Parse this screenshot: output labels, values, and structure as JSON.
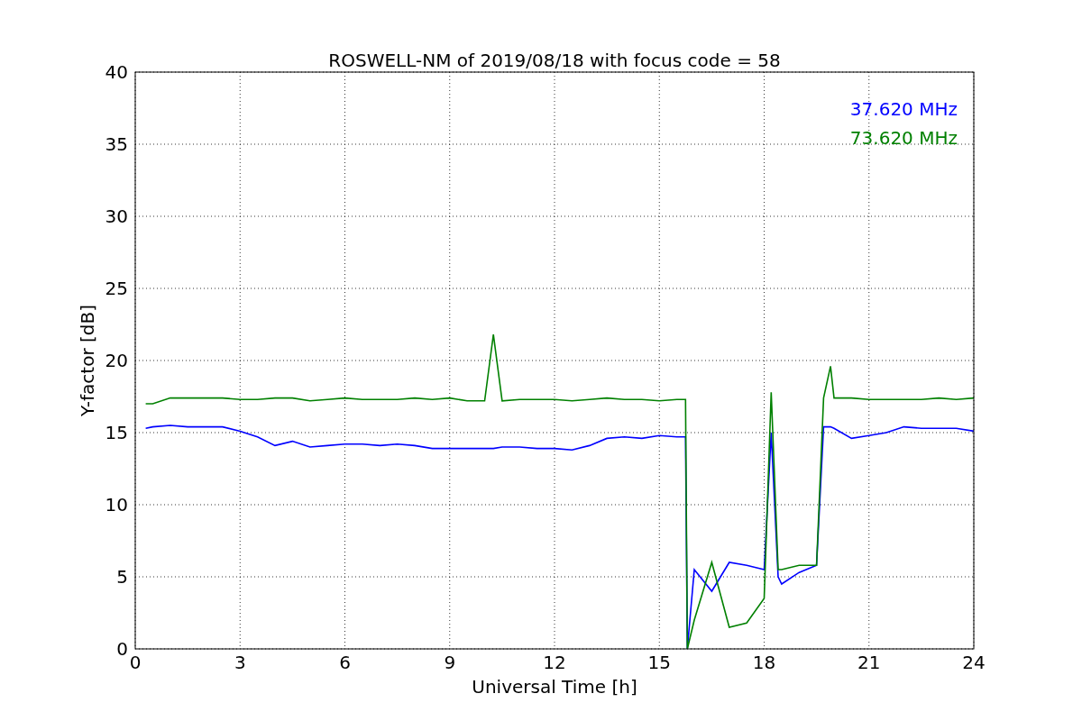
{
  "figure": {
    "chart_data": {
      "type": "line",
      "title": "ROSWELL-NM of 2019/08/18 with focus code = 58",
      "xlabel": "Universal Time [h]",
      "ylabel": "Y-factor [dB]",
      "x": [
        0.3,
        0.5,
        1,
        1.5,
        2,
        2.5,
        3,
        3.5,
        4,
        4.5,
        5,
        5.5,
        6,
        6.5,
        7,
        7.5,
        8,
        8.5,
        9,
        9.5,
        10,
        10.25,
        10.5,
        11,
        11.5,
        12,
        12.5,
        13,
        13.5,
        14,
        14.5,
        15,
        15.5,
        15.75,
        15.8,
        16,
        16.5,
        17,
        17.5,
        18,
        18.2,
        18.4,
        18.5,
        19,
        19.5,
        19.7,
        19.9,
        20,
        20.5,
        21,
        21.5,
        22,
        22.5,
        23,
        23.5,
        24
      ],
      "series": [
        {
          "name": "37.620 MHz",
          "color": "#0000ff",
          "values": [
            15.3,
            15.4,
            15.5,
            15.4,
            15.4,
            15.4,
            15.1,
            14.7,
            14.1,
            14.4,
            14.0,
            14.1,
            14.2,
            14.2,
            14.1,
            14.2,
            14.1,
            13.9,
            13.9,
            13.9,
            13.9,
            13.9,
            14.0,
            14.0,
            13.9,
            13.9,
            13.8,
            14.1,
            14.6,
            14.7,
            14.6,
            14.8,
            14.7,
            14.7,
            0,
            5.5,
            4.0,
            6.0,
            5.8,
            5.5,
            15.0,
            5.0,
            4.5,
            5.3,
            5.8,
            15.4,
            15.4,
            15.3,
            14.6,
            14.8,
            15.0,
            15.4,
            15.3,
            15.3,
            15.3,
            15.1
          ]
        },
        {
          "name": "73.620 MHz",
          "color": "#008000",
          "values": [
            17.0,
            17.0,
            17.4,
            17.4,
            17.4,
            17.4,
            17.3,
            17.3,
            17.4,
            17.4,
            17.2,
            17.3,
            17.4,
            17.3,
            17.3,
            17.3,
            17.4,
            17.3,
            17.4,
            17.2,
            17.2,
            21.8,
            17.2,
            17.3,
            17.3,
            17.3,
            17.2,
            17.3,
            17.4,
            17.3,
            17.3,
            17.2,
            17.3,
            17.3,
            0,
            2.0,
            6.0,
            1.5,
            1.8,
            3.5,
            17.8,
            5.5,
            5.5,
            5.8,
            5.8,
            17.4,
            19.6,
            17.4,
            17.4,
            17.3,
            17.3,
            17.3,
            17.3,
            17.4,
            17.3,
            17.4
          ]
        }
      ],
      "grid": true,
      "xlim": [
        0,
        24
      ],
      "ylim": [
        0,
        40
      ],
      "xticks": [
        0,
        3,
        6,
        9,
        12,
        15,
        18,
        21,
        24
      ],
      "yticks": [
        0,
        5,
        10,
        15,
        20,
        25,
        30,
        35,
        40
      ]
    }
  }
}
